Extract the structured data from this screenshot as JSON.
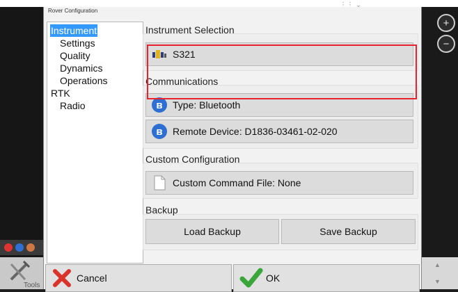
{
  "background": {
    "tools_label": "Tools"
  },
  "dialog": {
    "title": "Rover Configuration"
  },
  "nav": {
    "items": [
      {
        "label": "Instrument",
        "selected": true
      },
      {
        "label": "Settings"
      },
      {
        "label": "Quality"
      },
      {
        "label": "Dynamics"
      },
      {
        "label": "Operations"
      },
      {
        "label": "RTK"
      },
      {
        "label": "Radio"
      }
    ]
  },
  "instrument_selection": {
    "heading": "Instrument Selection",
    "instrument": "S321"
  },
  "communications": {
    "heading": "Communications",
    "type": "Type: Bluetooth",
    "remote_device": "Remote Device: D1836-03461-02-020"
  },
  "custom_configuration": {
    "heading": "Custom Configuration",
    "command_file": "Custom Command File: None"
  },
  "backup": {
    "heading": "Backup",
    "load": "Load Backup",
    "save": "Save Backup"
  },
  "footer": {
    "cancel": "Cancel",
    "ok": "OK"
  },
  "colors": {
    "selection": "#3399ff",
    "highlight_box": "#e8232d",
    "cancel_icon": "#d9342b",
    "ok_icon": "#3aa63a",
    "bluetooth": "#2e6fd1"
  }
}
